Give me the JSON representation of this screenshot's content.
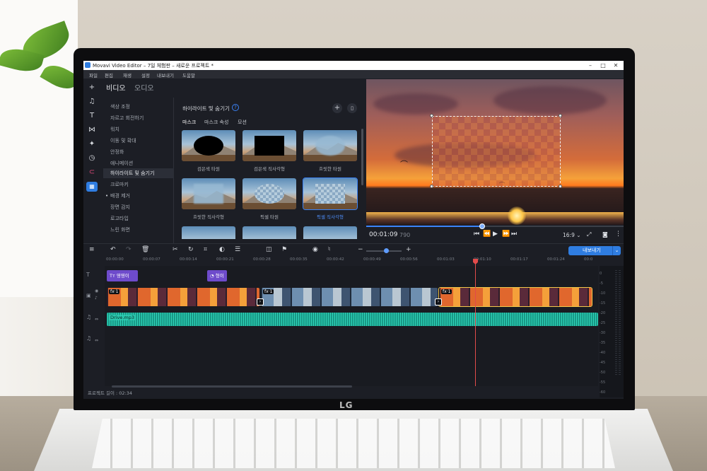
{
  "window": {
    "title": "Movavi Video Editor – 7일 체험판 – 새로운 프로젝트 *",
    "buttons": [
      "–",
      "□",
      "✕"
    ]
  },
  "menu": [
    "파일",
    "편집",
    "재생",
    "설정",
    "내보내기",
    "도움말"
  ],
  "tabs": {
    "video": "비디오",
    "audio": "오디오"
  },
  "fx_list": [
    "색상 조정",
    "자르고 회전하기",
    "워치",
    "이동 및 확대",
    "안정화",
    "애니메이션",
    "하이라이트 및 숨기기",
    "크로마키",
    "배경 제거",
    "장면 감지",
    "로고타입",
    "느린 화면"
  ],
  "fx_selected_index": 6,
  "panel": {
    "title": "하이라이트 및 숨기기",
    "help": "?",
    "add": "+",
    "subtabs": [
      "마스크",
      "마스크 속성",
      "모션"
    ],
    "cards": [
      {
        "caption": "검은색 타원",
        "shape": "ellipse-black"
      },
      {
        "caption": "검은색 직사각형",
        "shape": "rect-black"
      },
      {
        "caption": "흐릿한 타원",
        "shape": "ellipse-blur"
      },
      {
        "caption": "흐릿한 직사각형",
        "shape": "rect-blur"
      },
      {
        "caption": "픽셀 타원",
        "shape": "pixel ellipse-pixel"
      },
      {
        "caption": "픽셀 직사각형",
        "shape": "pixel",
        "selected": true
      }
    ]
  },
  "player": {
    "time": "00:01:09",
    "time_ms": "790",
    "progress": 0.45,
    "ratio": "16:9 ⌄",
    "controls": [
      "⏮",
      "⏪",
      "▶",
      "⏩",
      "⏭"
    ]
  },
  "toolbar": {
    "export_label": "내보내기",
    "zoom": 0.55
  },
  "ruler": [
    "00:00:00",
    "00:00:07",
    "00:00:14",
    "00:00:21",
    "00:00:28",
    "00:00:35",
    "00:00:42",
    "00:00:49",
    "00:00:56",
    "00:01:03",
    "00:01:10",
    "00:01:17",
    "00:01:24",
    "00:0"
  ],
  "clips": {
    "title1": "영영이",
    "title2": "형이",
    "fx_tag": "fx·1",
    "audio": "Drive.mp3"
  },
  "meter_scale": [
    "0",
    "-5",
    "-10",
    "-15",
    "-20",
    "-25",
    "-30",
    "-35",
    "-40",
    "-45",
    "-50",
    "-55",
    "-60"
  ],
  "status": {
    "label": "프로젝트 길이 : 02:34"
  },
  "laptop_brand": "LG",
  "colors": {
    "accent": "#2f7de1",
    "title_clip": "#6e4bcb",
    "audio_clip": "#2fd1b6",
    "playhead": "#e24b4b"
  }
}
